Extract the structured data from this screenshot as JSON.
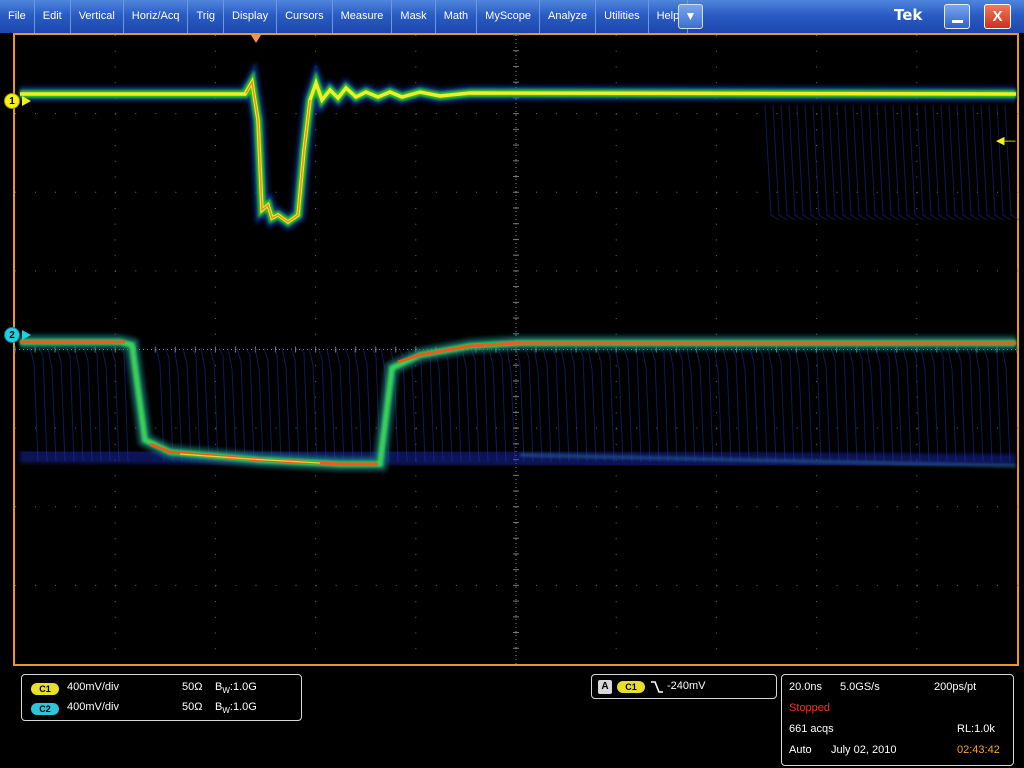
{
  "menu": {
    "items": [
      {
        "id": "file",
        "label": "File"
      },
      {
        "id": "edit",
        "label": "Edit"
      },
      {
        "id": "vertical",
        "label": "Vertical"
      },
      {
        "id": "horiz-acq",
        "label": "Horiz/Acq"
      },
      {
        "id": "trig",
        "label": "Trig"
      },
      {
        "id": "display",
        "label": "Display"
      },
      {
        "id": "cursors",
        "label": "Cursors"
      },
      {
        "id": "measure",
        "label": "Measure"
      },
      {
        "id": "mask",
        "label": "Mask"
      },
      {
        "id": "math",
        "label": "Math"
      },
      {
        "id": "myscope",
        "label": "MyScope"
      },
      {
        "id": "analyze",
        "label": "Analyze"
      },
      {
        "id": "utilities",
        "label": "Utilities"
      },
      {
        "id": "help",
        "label": "Help"
      }
    ],
    "dropdown_icon": "▼",
    "logo": "Tek",
    "close_label": "X"
  },
  "markers": {
    "ch1": "1",
    "ch2": "2"
  },
  "channels": [
    {
      "badge": "C1",
      "scale": "400mV/div",
      "impedance": "50Ω",
      "bw_prefix": "B",
      "bw_sub": "W",
      "bw_value": ":1.0G"
    },
    {
      "badge": "C2",
      "scale": "400mV/div",
      "impedance": "50Ω",
      "bw_prefix": "B",
      "bw_sub": "W",
      "bw_value": ":1.0G"
    }
  ],
  "trigger": {
    "mode": "A",
    "source": "C1",
    "slope_icon": "falling-edge",
    "level": "-240mV"
  },
  "acquisition": {
    "time_per_div": "20.0ns",
    "sample_rate": "5.0GS/s",
    "resolution": "200ps/pt",
    "state": "Stopped",
    "acqs": "661 acqs",
    "record_length": "RL:1.0k",
    "trigger_mode": "Auto",
    "date": "July 02, 2010",
    "time": "02:43:42"
  },
  "colors": {
    "accent": "#e8972b",
    "ch1": "#f4f21a",
    "ch2": "#22d0e6",
    "stopped": "#ff2a1a",
    "time": "#ffa21e",
    "menubar": "#2a5cc4"
  }
}
